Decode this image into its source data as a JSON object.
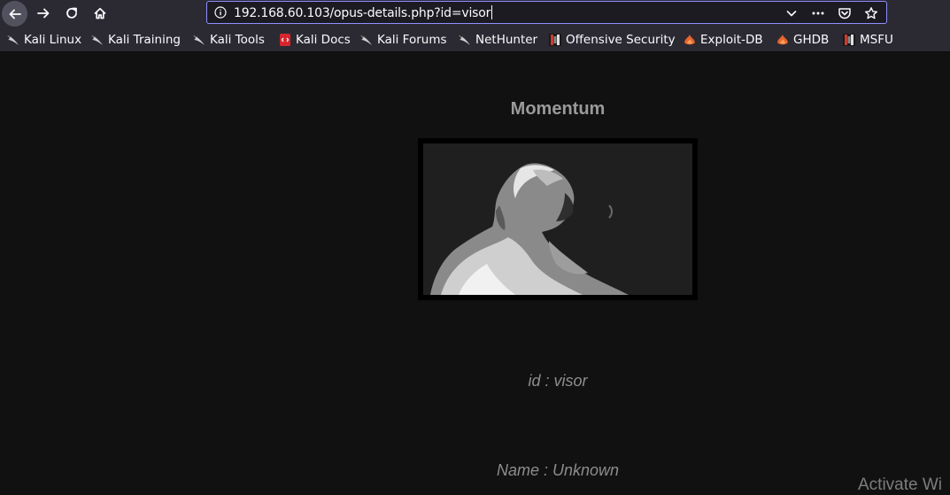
{
  "browser": {
    "url": "192.168.60.103/opus-details.php?id=visor",
    "nav": {
      "back_icon": "back-arrow-icon",
      "forward_icon": "forward-arrow-icon",
      "reload_icon": "reload-icon",
      "home_icon": "home-icon"
    },
    "url_actions": [
      "chevron-down-icon",
      "more-dots-icon",
      "pocket-icon",
      "bookmark-star-icon"
    ]
  },
  "bookmarks": [
    {
      "label": "Kali Linux",
      "icon": "kali-dragon-icon"
    },
    {
      "label": "Kali Training",
      "icon": "kali-dragon-icon"
    },
    {
      "label": "Kali Tools",
      "icon": "kali-dragon-icon"
    },
    {
      "label": "Kali Docs",
      "icon": "kali-docs-icon"
    },
    {
      "label": "Kali Forums",
      "icon": "kali-dragon-icon"
    },
    {
      "label": "NetHunter",
      "icon": "kali-dragon-icon"
    },
    {
      "label": "Offensive Security",
      "icon": "offsec-icon"
    },
    {
      "label": "Exploit-DB",
      "icon": "exploitdb-icon"
    },
    {
      "label": "GHDB",
      "icon": "exploitdb-icon"
    },
    {
      "label": "MSFU",
      "icon": "offsec-icon"
    }
  ],
  "page": {
    "title": "Momentum",
    "id_line": "id : visor",
    "name_line": "Name : Unknown"
  },
  "overlay": {
    "watermark": "Activate Wi"
  },
  "colors": {
    "page_background": "#111111",
    "toolbar": "#2b2a33",
    "url_focus_border": "#8f8fff"
  }
}
